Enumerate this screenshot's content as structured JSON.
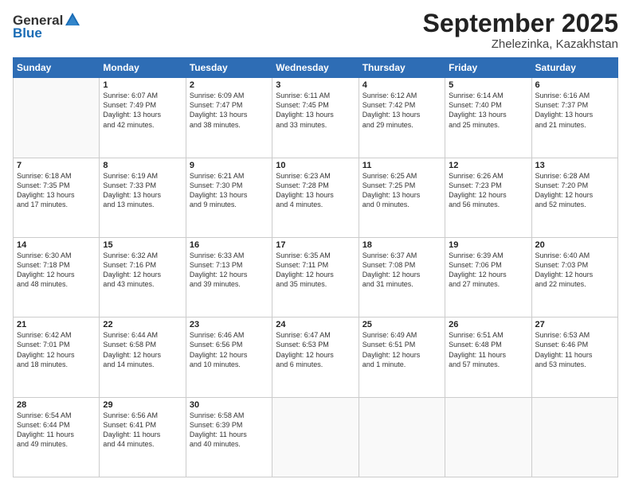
{
  "header": {
    "logo_general": "General",
    "logo_blue": "Blue",
    "title": "September 2025",
    "location": "Zhelezinka, Kazakhstan"
  },
  "weekdays": [
    "Sunday",
    "Monday",
    "Tuesday",
    "Wednesday",
    "Thursday",
    "Friday",
    "Saturday"
  ],
  "weeks": [
    [
      {
        "day": "",
        "info": ""
      },
      {
        "day": "1",
        "info": "Sunrise: 6:07 AM\nSunset: 7:49 PM\nDaylight: 13 hours\nand 42 minutes."
      },
      {
        "day": "2",
        "info": "Sunrise: 6:09 AM\nSunset: 7:47 PM\nDaylight: 13 hours\nand 38 minutes."
      },
      {
        "day": "3",
        "info": "Sunrise: 6:11 AM\nSunset: 7:45 PM\nDaylight: 13 hours\nand 33 minutes."
      },
      {
        "day": "4",
        "info": "Sunrise: 6:12 AM\nSunset: 7:42 PM\nDaylight: 13 hours\nand 29 minutes."
      },
      {
        "day": "5",
        "info": "Sunrise: 6:14 AM\nSunset: 7:40 PM\nDaylight: 13 hours\nand 25 minutes."
      },
      {
        "day": "6",
        "info": "Sunrise: 6:16 AM\nSunset: 7:37 PM\nDaylight: 13 hours\nand 21 minutes."
      }
    ],
    [
      {
        "day": "7",
        "info": "Sunrise: 6:18 AM\nSunset: 7:35 PM\nDaylight: 13 hours\nand 17 minutes."
      },
      {
        "day": "8",
        "info": "Sunrise: 6:19 AM\nSunset: 7:33 PM\nDaylight: 13 hours\nand 13 minutes."
      },
      {
        "day": "9",
        "info": "Sunrise: 6:21 AM\nSunset: 7:30 PM\nDaylight: 13 hours\nand 9 minutes."
      },
      {
        "day": "10",
        "info": "Sunrise: 6:23 AM\nSunset: 7:28 PM\nDaylight: 13 hours\nand 4 minutes."
      },
      {
        "day": "11",
        "info": "Sunrise: 6:25 AM\nSunset: 7:25 PM\nDaylight: 13 hours\nand 0 minutes."
      },
      {
        "day": "12",
        "info": "Sunrise: 6:26 AM\nSunset: 7:23 PM\nDaylight: 12 hours\nand 56 minutes."
      },
      {
        "day": "13",
        "info": "Sunrise: 6:28 AM\nSunset: 7:20 PM\nDaylight: 12 hours\nand 52 minutes."
      }
    ],
    [
      {
        "day": "14",
        "info": "Sunrise: 6:30 AM\nSunset: 7:18 PM\nDaylight: 12 hours\nand 48 minutes."
      },
      {
        "day": "15",
        "info": "Sunrise: 6:32 AM\nSunset: 7:16 PM\nDaylight: 12 hours\nand 43 minutes."
      },
      {
        "day": "16",
        "info": "Sunrise: 6:33 AM\nSunset: 7:13 PM\nDaylight: 12 hours\nand 39 minutes."
      },
      {
        "day": "17",
        "info": "Sunrise: 6:35 AM\nSunset: 7:11 PM\nDaylight: 12 hours\nand 35 minutes."
      },
      {
        "day": "18",
        "info": "Sunrise: 6:37 AM\nSunset: 7:08 PM\nDaylight: 12 hours\nand 31 minutes."
      },
      {
        "day": "19",
        "info": "Sunrise: 6:39 AM\nSunset: 7:06 PM\nDaylight: 12 hours\nand 27 minutes."
      },
      {
        "day": "20",
        "info": "Sunrise: 6:40 AM\nSunset: 7:03 PM\nDaylight: 12 hours\nand 22 minutes."
      }
    ],
    [
      {
        "day": "21",
        "info": "Sunrise: 6:42 AM\nSunset: 7:01 PM\nDaylight: 12 hours\nand 18 minutes."
      },
      {
        "day": "22",
        "info": "Sunrise: 6:44 AM\nSunset: 6:58 PM\nDaylight: 12 hours\nand 14 minutes."
      },
      {
        "day": "23",
        "info": "Sunrise: 6:46 AM\nSunset: 6:56 PM\nDaylight: 12 hours\nand 10 minutes."
      },
      {
        "day": "24",
        "info": "Sunrise: 6:47 AM\nSunset: 6:53 PM\nDaylight: 12 hours\nand 6 minutes."
      },
      {
        "day": "25",
        "info": "Sunrise: 6:49 AM\nSunset: 6:51 PM\nDaylight: 12 hours\nand 1 minute."
      },
      {
        "day": "26",
        "info": "Sunrise: 6:51 AM\nSunset: 6:48 PM\nDaylight: 11 hours\nand 57 minutes."
      },
      {
        "day": "27",
        "info": "Sunrise: 6:53 AM\nSunset: 6:46 PM\nDaylight: 11 hours\nand 53 minutes."
      }
    ],
    [
      {
        "day": "28",
        "info": "Sunrise: 6:54 AM\nSunset: 6:44 PM\nDaylight: 11 hours\nand 49 minutes."
      },
      {
        "day": "29",
        "info": "Sunrise: 6:56 AM\nSunset: 6:41 PM\nDaylight: 11 hours\nand 44 minutes."
      },
      {
        "day": "30",
        "info": "Sunrise: 6:58 AM\nSunset: 6:39 PM\nDaylight: 11 hours\nand 40 minutes."
      },
      {
        "day": "",
        "info": ""
      },
      {
        "day": "",
        "info": ""
      },
      {
        "day": "",
        "info": ""
      },
      {
        "day": "",
        "info": ""
      }
    ]
  ]
}
